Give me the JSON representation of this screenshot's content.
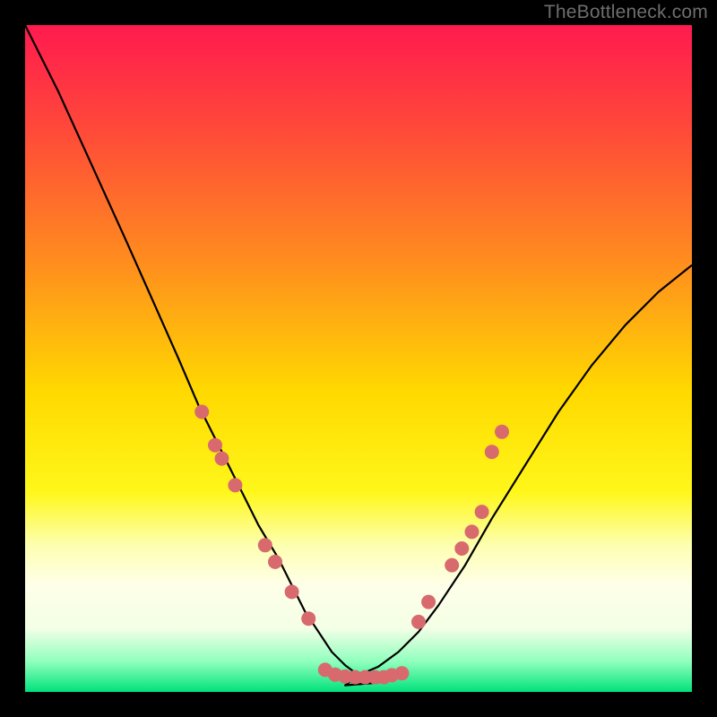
{
  "watermark": "TheBottleneck.com",
  "chart_data": {
    "type": "line",
    "title": "",
    "xlabel": "",
    "ylabel": "",
    "xlim": [
      0,
      100
    ],
    "ylim": [
      0,
      100
    ],
    "gradient_stops": [
      {
        "offset": 0,
        "color": "#ff1a4f"
      },
      {
        "offset": 0.15,
        "color": "#ff473a"
      },
      {
        "offset": 0.35,
        "color": "#ff8b1f"
      },
      {
        "offset": 0.55,
        "color": "#ffd900"
      },
      {
        "offset": 0.7,
        "color": "#fff71a"
      },
      {
        "offset": 0.78,
        "color": "#fdffb0"
      },
      {
        "offset": 0.84,
        "color": "#ffffe8"
      },
      {
        "offset": 0.905,
        "color": "#f3ffe6"
      },
      {
        "offset": 0.955,
        "color": "#8fffbd"
      },
      {
        "offset": 1.0,
        "color": "#00e27b"
      }
    ],
    "series": [
      {
        "name": "curve",
        "x": [
          0,
          5,
          10,
          15,
          19,
          23,
          26,
          29,
          32,
          35,
          38,
          40,
          42,
          44,
          46,
          48,
          50,
          53,
          56,
          59,
          62,
          66,
          70,
          75,
          80,
          85,
          90,
          95,
          100
        ],
        "y_down": [
          100,
          90,
          79,
          68,
          59,
          50,
          43,
          37,
          31,
          25,
          20,
          16,
          12,
          9,
          6,
          4,
          2.5,
          1.4,
          1,
          1,
          1,
          1,
          1,
          1,
          1,
          1,
          1,
          1,
          1
        ],
        "y_up": [
          1,
          1,
          1,
          1,
          1,
          1,
          1,
          1,
          1,
          1,
          1,
          1,
          1,
          1,
          1,
          1,
          2.5,
          3.8,
          6,
          9,
          13,
          19,
          26,
          34,
          42,
          49,
          55,
          60,
          64
        ]
      }
    ],
    "markers": {
      "name": "dots",
      "color": "#d86a6e",
      "r": 8,
      "points": [
        {
          "x": 26.5,
          "y": 42
        },
        {
          "x": 28.5,
          "y": 37
        },
        {
          "x": 29.5,
          "y": 35
        },
        {
          "x": 31.5,
          "y": 31
        },
        {
          "x": 36.0,
          "y": 22
        },
        {
          "x": 37.5,
          "y": 19.5
        },
        {
          "x": 40.0,
          "y": 15
        },
        {
          "x": 42.5,
          "y": 11
        },
        {
          "x": 45.0,
          "y": 3.3
        },
        {
          "x": 46.5,
          "y": 2.6
        },
        {
          "x": 48.0,
          "y": 2.3
        },
        {
          "x": 49.5,
          "y": 2.2
        },
        {
          "x": 51.0,
          "y": 2.2
        },
        {
          "x": 52.5,
          "y": 2.2
        },
        {
          "x": 53.8,
          "y": 2.2
        },
        {
          "x": 55.0,
          "y": 2.5
        },
        {
          "x": 56.5,
          "y": 2.8
        },
        {
          "x": 59.0,
          "y": 10.5
        },
        {
          "x": 60.5,
          "y": 13.5
        },
        {
          "x": 64.0,
          "y": 19
        },
        {
          "x": 65.5,
          "y": 21.5
        },
        {
          "x": 67.0,
          "y": 24
        },
        {
          "x": 68.5,
          "y": 27
        },
        {
          "x": 70.0,
          "y": 36
        },
        {
          "x": 71.5,
          "y": 39
        }
      ]
    }
  }
}
